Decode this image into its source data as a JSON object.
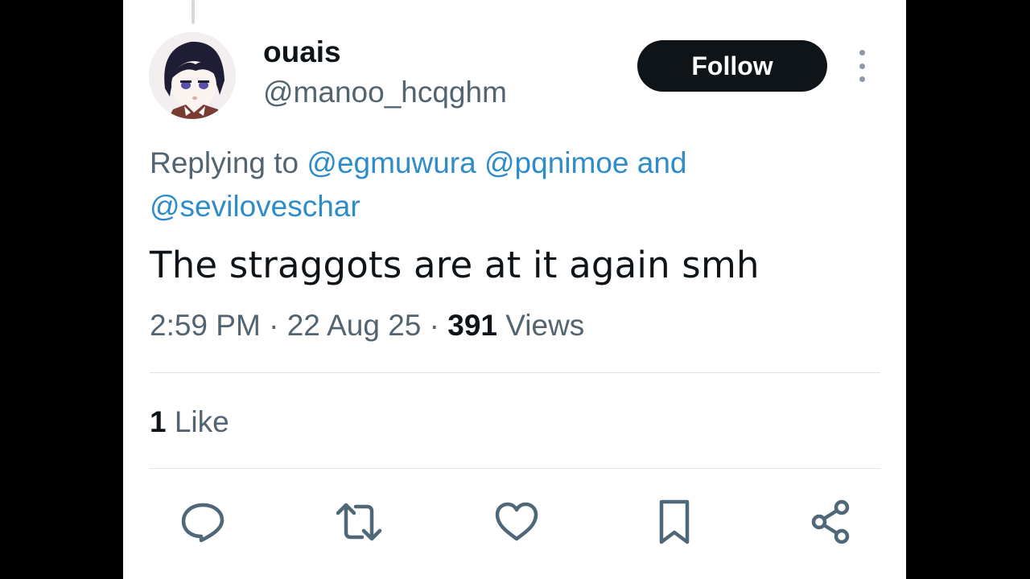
{
  "author": {
    "name": "ouais",
    "handle": "@manoo_hcqghm"
  },
  "follow_label": "Follow",
  "replying": {
    "prefix": "Replying to",
    "mention1": "@egmuwura",
    "mention2": "@pqnimoe",
    "joiner": "and",
    "mention3": "@seviloveschar"
  },
  "tweet_text": "The straggots are at it again smh",
  "meta": {
    "time": "2:59 PM",
    "date": "22 Aug 25",
    "views_count": "391",
    "views_label": "Views"
  },
  "likes": {
    "count": "1",
    "label": "Like"
  },
  "colors": {
    "text": "#0f1419",
    "secondary": "#536471",
    "mention": "#2e8cc9",
    "icon": "#4f6877"
  },
  "icons": [
    "reply-icon",
    "retweet-icon",
    "like-icon",
    "bookmark-icon",
    "share-icon"
  ]
}
